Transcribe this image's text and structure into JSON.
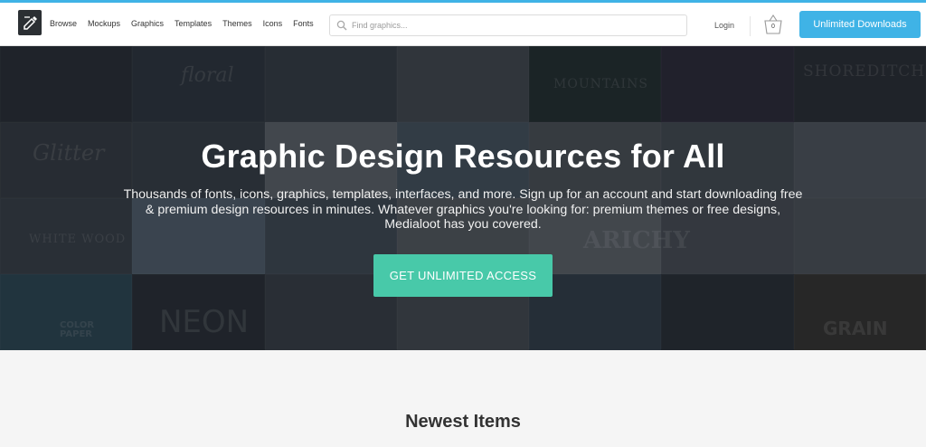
{
  "header": {
    "logo_label": "Medialoot",
    "nav": [
      "Browse",
      "Mockups",
      "Graphics",
      "Templates",
      "Themes",
      "Icons",
      "Fonts"
    ],
    "search": {
      "placeholder": "Find graphics..."
    },
    "login_label": "Login",
    "cart_count": "0",
    "cta_label": "Unlimited Downloads"
  },
  "hero": {
    "title": "Graphic Design Resources for All",
    "description": "Thousands of fonts, icons, graphics, templates, interfaces, and more. Sign up for an account and start downloading free & premium design resources in minutes. Whatever graphics you're looking for: premium themes or free designs, Medialoot has you covered.",
    "button_label": "GET UNLIMITED ACCESS",
    "background_texts": [
      "floral",
      "MOUNTAINS",
      "SHOREDITCH",
      "Glitter",
      "WHITE WOOD",
      "ARICHY",
      "NEON",
      "COLOR PAPER",
      "GRAIN"
    ]
  },
  "section": {
    "title": "Newest Items"
  },
  "colors": {
    "accent_blue": "#3fb3e6",
    "accent_green": "#48c9a9",
    "hero_dark": "#20252c"
  }
}
